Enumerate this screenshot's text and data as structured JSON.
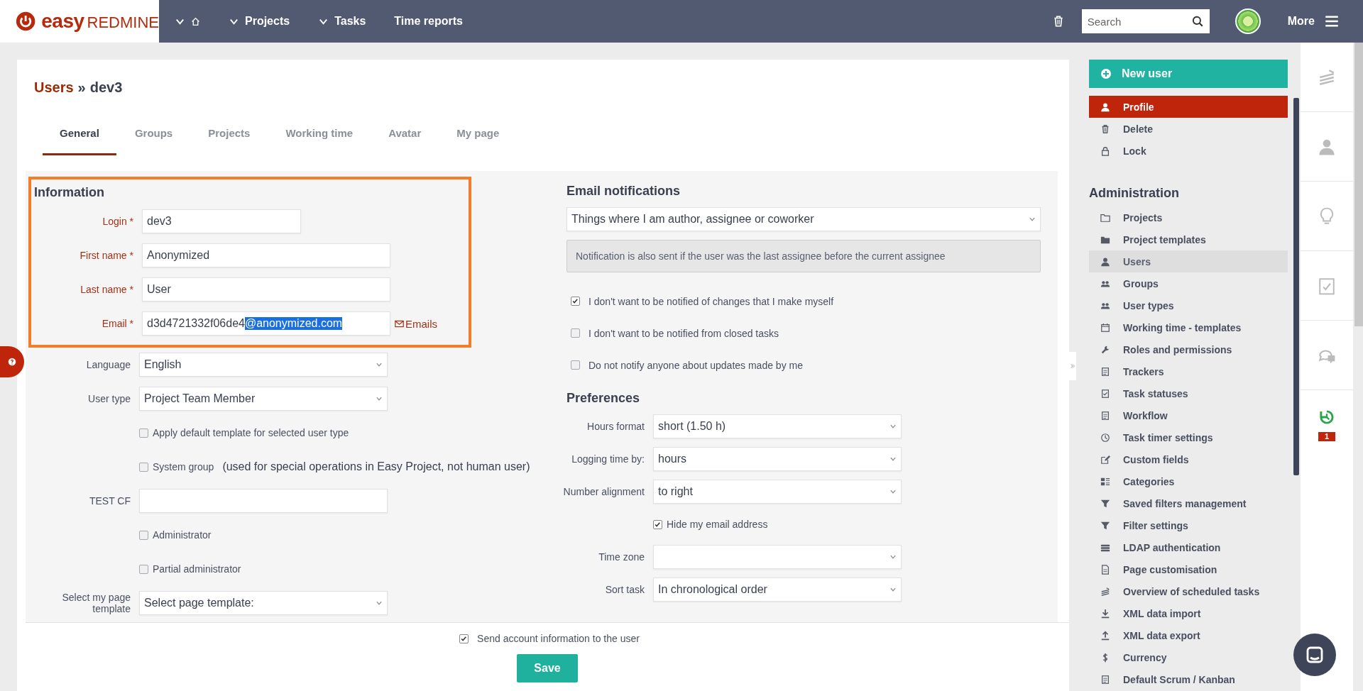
{
  "topbar": {
    "logo": {
      "left": "easy",
      "right": "REDMINE"
    },
    "nav": [
      {
        "kind": "home",
        "dropdown": true
      },
      {
        "kind": "text",
        "label": "Projects",
        "dropdown": true
      },
      {
        "kind": "text",
        "label": "Tasks",
        "dropdown": true
      },
      {
        "kind": "text",
        "label": "Time reports",
        "dropdown": false
      }
    ],
    "search": {
      "placeholder": "Search"
    },
    "more": "More"
  },
  "breadcrumb": {
    "link": "Users",
    "separator": "»",
    "current": "dev3"
  },
  "tabs": [
    {
      "label": "General",
      "selected": true
    },
    {
      "label": "Groups",
      "selected": false
    },
    {
      "label": "Projects",
      "selected": false
    },
    {
      "label": "Working time",
      "selected": false
    },
    {
      "label": "Avatar",
      "selected": false
    },
    {
      "label": "My page",
      "selected": false
    }
  ],
  "information": {
    "heading": "Information",
    "highlighted": true,
    "fields": [
      {
        "kind": "short_text",
        "label": "Login *",
        "required": true,
        "value": "dev3"
      },
      {
        "kind": "text",
        "label": "First name *",
        "required": true,
        "value": "Anonymized"
      },
      {
        "kind": "text",
        "label": "Last name *",
        "required": true,
        "value": "User"
      },
      {
        "kind": "email",
        "label": "Email *",
        "required": true,
        "value": "d3d4721332f06de4",
        "selected_text": "@anonymized.com",
        "link": "Emails"
      }
    ]
  },
  "fields": [
    {
      "kind": "select",
      "label": "Language",
      "value": "English"
    },
    {
      "kind": "select",
      "label": "User type",
      "value": "Project Team Member"
    },
    {
      "kind": "checkbox",
      "label": "Apply default template for selected user type",
      "checked": false
    },
    {
      "kind": "checkbox",
      "label": "System group",
      "checked": false,
      "note": "(used for special operations in Easy Project, not human user)"
    },
    {
      "kind": "text",
      "label": "TEST CF"
    },
    {
      "kind": "checkbox",
      "label": "Administrator",
      "checked": false
    },
    {
      "kind": "checkbox",
      "label": "Partial administrator",
      "checked": false
    },
    {
      "kind": "select",
      "label": "Select my page template",
      "placeholder": "Select page template:"
    }
  ],
  "email_notifications": {
    "heading": "Email notifications",
    "value": "Things where I am author, assignee or coworker",
    "note": "Notification is also sent if the user was the last assignee before the current assignee",
    "options": [
      {
        "label": "I don't want to be notified of changes that I make myself",
        "checked": true
      },
      {
        "label": "I don't want to be notified from closed tasks",
        "checked": false
      },
      {
        "label": "Do not notify anyone about updates made by me",
        "checked": false
      }
    ]
  },
  "preferences": {
    "heading": "Preferences",
    "fields": [
      {
        "kind": "select",
        "label": "Hours format",
        "value": "short (1.50 h)"
      },
      {
        "kind": "select",
        "label": "Logging time by:",
        "value": "hours"
      },
      {
        "kind": "select",
        "label": "Number alignment",
        "value": "to right"
      },
      {
        "kind": "checkbox",
        "label": "Hide my email address",
        "checked": true
      },
      {
        "kind": "select",
        "label": "Time zone"
      },
      {
        "kind": "select",
        "label": "Sort task",
        "value": "In chronological order"
      }
    ]
  },
  "footer": {
    "send_info": {
      "label": "Send account information to the user",
      "checked": true
    },
    "save": "Save"
  },
  "sidebar": {
    "new_button": "New user",
    "actions": [
      {
        "label": "Profile",
        "selected": true
      },
      {
        "label": "Delete",
        "selected": false
      },
      {
        "label": "Lock",
        "selected": false
      }
    ],
    "heading": "Administration",
    "items": [
      {
        "label": "Projects",
        "selected": false
      },
      {
        "label": "Project templates",
        "selected": false
      },
      {
        "label": "Users",
        "selected": true
      },
      {
        "label": "Groups",
        "selected": false
      },
      {
        "label": "User types",
        "selected": false
      },
      {
        "label": "Working time - templates",
        "selected": false
      },
      {
        "label": "Roles and permissions",
        "selected": false
      },
      {
        "label": "Trackers",
        "selected": false
      },
      {
        "label": "Task statuses",
        "selected": false
      },
      {
        "label": "Workflow",
        "selected": false
      },
      {
        "label": "Task timer settings",
        "selected": false
      },
      {
        "label": "Custom fields",
        "selected": false
      },
      {
        "label": "Categories",
        "selected": false
      },
      {
        "label": "Saved filters management",
        "selected": false
      },
      {
        "label": "Filter settings",
        "selected": false
      },
      {
        "label": "LDAP authentication",
        "selected": false
      },
      {
        "label": "Page customisation",
        "selected": false
      },
      {
        "label": "Overview of scheduled tasks",
        "selected": false
      },
      {
        "label": "XML data import",
        "selected": false
      },
      {
        "label": "XML data export",
        "selected": false
      },
      {
        "label": "Currency",
        "selected": false
      },
      {
        "label": "Default Scrum / Kanban",
        "selected": false
      }
    ]
  },
  "side_strip": {
    "timer_badge": "1"
  }
}
